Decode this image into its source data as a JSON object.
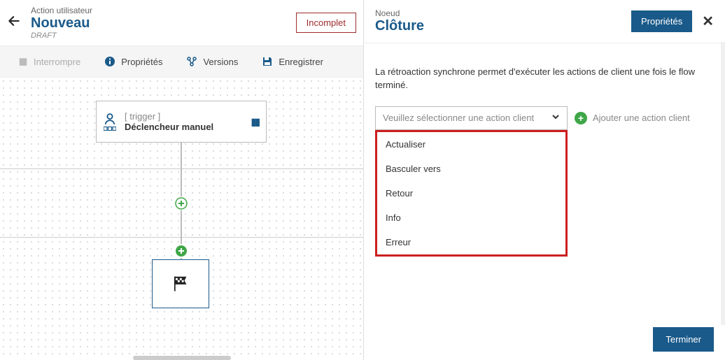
{
  "left": {
    "breadcrumb": "Action utilisateur",
    "title": "Nouveau",
    "subtitle": "DRAFT",
    "status": "Incomplet",
    "toolbar": {
      "interrupt": "Interrompre",
      "properties": "Propriétés",
      "versions": "Versions",
      "save": "Enregistrer"
    },
    "node_trigger": {
      "tag": "[ trigger ]",
      "label": "Déclencheur manuel"
    }
  },
  "right": {
    "breadcrumb": "Noeud",
    "title": "Clôture",
    "properties_btn": "Propriétés",
    "description": "La rétroaction synchrone permet d'exécuter les actions de client une fois le flow terminé.",
    "select_placeholder": "Veuillez sélectionner une action client",
    "add_action": "Ajouter une action client",
    "options": [
      "Actualiser",
      "Basculer vers",
      "Retour",
      "Info",
      "Erreur"
    ],
    "finish": "Terminer"
  }
}
